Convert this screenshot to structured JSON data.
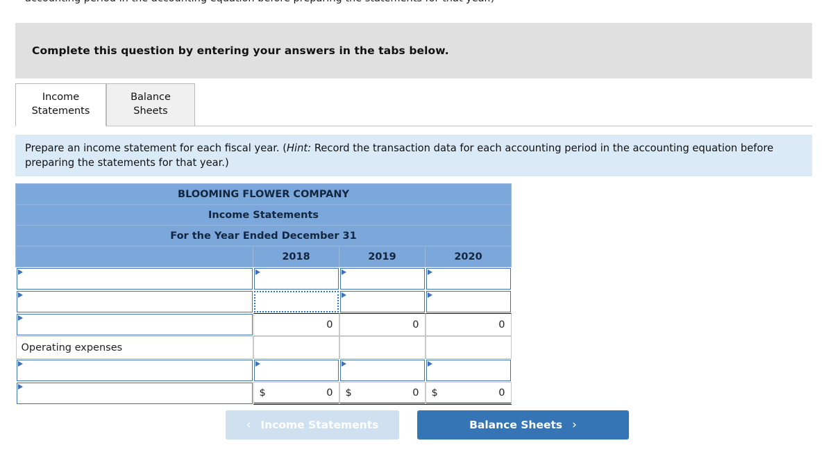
{
  "clipped_top_text": "accounting period in the accounting equation before preparing the statements for that year.)",
  "banner": {
    "title": "Complete this question by entering your answers in the tabs below."
  },
  "tabs": [
    {
      "id": "income-statements",
      "line1": "Income",
      "line2": "Statements",
      "active": true
    },
    {
      "id": "balance-sheets",
      "line1": "Balance",
      "line2": "Sheets",
      "active": false
    }
  ],
  "instruction": {
    "lead": "Prepare an income statement for each fiscal year. (",
    "hint_label": "Hint:",
    "rest": " Record the transaction data for each accounting period in the accounting equation before preparing the statements for that year.)"
  },
  "statement": {
    "company": "BLOOMING FLOWER COMPANY",
    "statement_title": "Income Statements",
    "period": "For the Year Ended December 31",
    "columns": [
      "2018",
      "2019",
      "2020"
    ],
    "rows": [
      {
        "type": "dropdown",
        "label": "",
        "values": [
          "",
          "",
          ""
        ]
      },
      {
        "type": "dropdown",
        "label": "",
        "values": [
          "",
          "",
          ""
        ],
        "focused_col": 0
      },
      {
        "type": "subtotal",
        "label": "",
        "values": [
          "0",
          "0",
          "0"
        ]
      },
      {
        "type": "static",
        "label": "Operating expenses",
        "values": [
          "",
          "",
          ""
        ]
      },
      {
        "type": "dropdown",
        "label": "",
        "values": [
          "",
          "",
          ""
        ]
      },
      {
        "type": "total",
        "label": "",
        "currency": "$",
        "values": [
          "0",
          "0",
          "0"
        ]
      }
    ]
  },
  "nav": {
    "prev_label": "Income Statements",
    "prev_chevron": "‹",
    "next_label": "Balance Sheets",
    "next_chevron": "›"
  },
  "colors": {
    "header_blue": "#7ba7db",
    "panel_blue": "#daeaf7",
    "banner_gray": "#e0e0e0",
    "button_blue": "#3575b5",
    "button_disabled": "#cfe0f0",
    "input_border": "#3f72b5"
  }
}
